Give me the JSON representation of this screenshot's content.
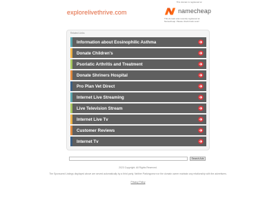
{
  "header": {
    "domain": "explorelivethrive.com",
    "registered_note": "This domain is registered at",
    "registrar_name": "namecheap",
    "registrar_note": "This domain was recently registered at Namecheap. Please check back soon!",
    "brand_color": "#e05f35",
    "logo_color": "#ff6a13"
  },
  "panel": {
    "title": "Related Links",
    "links": [
      {
        "label": "Information about Eosinophilic Asthma",
        "accent": "#59a6ae"
      },
      {
        "label": "Donate Children's",
        "accent": "#f0b448"
      },
      {
        "label": "Psoriatic Arthritis and Treatment",
        "accent": "#a9c860"
      },
      {
        "label": "Donate Shriners Hospital",
        "accent": "#e0893e"
      },
      {
        "label": "Pro Plan Vet Direct",
        "accent": "#3b5f83"
      },
      {
        "label": "Internet Live Streaming",
        "accent": "#59a6ae"
      },
      {
        "label": "Live Television Stream",
        "accent": "#a9c860"
      },
      {
        "label": "Internet Live Tv",
        "accent": "#f0b448"
      },
      {
        "label": "Customer Reviews",
        "accent": "#e0893e"
      },
      {
        "label": "Internet Tv",
        "accent": "#3b5f83"
      }
    ],
    "arrow_color": "#e0393e",
    "arrow_icon": "arrow-right-icon"
  },
  "search": {
    "placeholder": "",
    "button_label": "Search Ads"
  },
  "footer": {
    "copyright": "2023 Copyright. All Rights Reserved.",
    "disclaimer": "The Sponsored Listings displayed above are served automatically by a third party. Neither Parkingcrew nor the domain owner maintain any relationship with the advertisers.",
    "privacy_label": "Privacy Policy"
  }
}
